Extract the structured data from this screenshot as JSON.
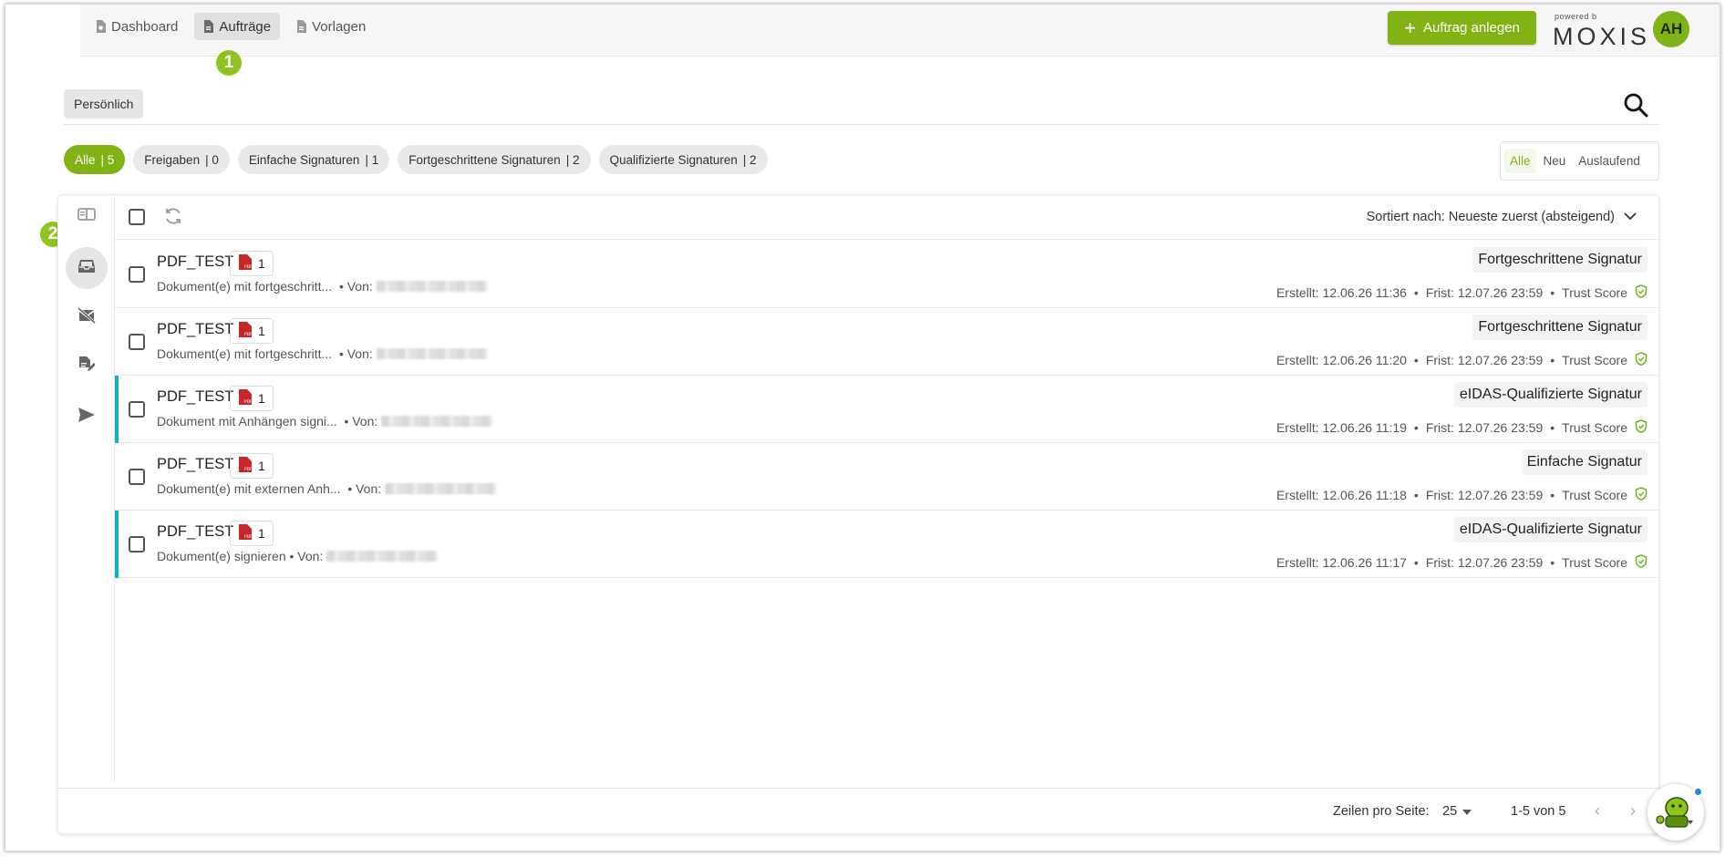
{
  "nav": {
    "items": [
      {
        "label": "Dashboard",
        "active": false
      },
      {
        "label": "Aufträge",
        "active": true
      },
      {
        "label": "Vorlagen",
        "active": false
      }
    ]
  },
  "annotations": {
    "one": "1",
    "two": "2"
  },
  "header": {
    "new_order_label": "Auftrag anlegen",
    "logo_powered": "powered b",
    "logo_name": "MOXIS",
    "avatar_initials": "AH",
    "accent_color": "#82b314"
  },
  "scope": {
    "label": "Persönlich"
  },
  "tabs": [
    {
      "label": "Alle",
      "count": "| 5",
      "active": true
    },
    {
      "label": "Freigaben",
      "count": "| 0",
      "active": false
    },
    {
      "label": "Einfache Signaturen",
      "count": "| 1",
      "active": false
    },
    {
      "label": "Fortgeschrittene Signaturen",
      "count": "| 2",
      "active": false
    },
    {
      "label": "Qualifizierte Signaturen",
      "count": "| 2",
      "active": false
    }
  ],
  "segments": [
    {
      "label": "Alle",
      "active": true
    },
    {
      "label": "Neu",
      "active": false
    },
    {
      "label": "Auslaufend",
      "active": false
    }
  ],
  "sidebar_icons": [
    "columns-icon",
    "inbox-icon",
    "hidden-mail-icon",
    "doc-edit-icon",
    "send-icon"
  ],
  "list": {
    "sort_label": "Sortiert nach: Neueste zuerst (absteigend)",
    "rows": [
      {
        "title": "PDF_TEST",
        "pdf_count": "1",
        "desc": "Dokument(e) mit fortgeschritt...",
        "from": "• Von:",
        "sigtype": "Fortgeschrittene Signatur",
        "created": "Erstellt: 12.06.26 11:36",
        "deadline": "Frist: 12.07.26 23:59",
        "trust": "Trust Score",
        "flag": false
      },
      {
        "title": "PDF_TEST",
        "pdf_count": "1",
        "desc": "Dokument(e) mit fortgeschritt...",
        "from": "• Von:",
        "sigtype": "Fortgeschrittene Signatur",
        "created": "Erstellt: 12.06.26 11:20",
        "deadline": "Frist: 12.07.26 23:59",
        "trust": "Trust Score",
        "flag": false
      },
      {
        "title": "PDF_TEST",
        "pdf_count": "1",
        "desc": "Dokument mit Anhängen signi...",
        "from": "• Von:",
        "sigtype": "eIDAS-Qualifizierte Signatur",
        "created": "Erstellt: 12.06.26 11:19",
        "deadline": "Frist: 12.07.26 23:59",
        "trust": "Trust Score",
        "flag": true
      },
      {
        "title": "PDF_TEST",
        "pdf_count": "1",
        "desc": "Dokument(e) mit externen Anh...",
        "from": "• Von:",
        "sigtype": "Einfache Signatur",
        "created": "Erstellt: 12.06.26 11:18",
        "deadline": "Frist: 12.07.26 23:59",
        "trust": "Trust Score",
        "flag": false
      },
      {
        "title": "PDF_TEST",
        "pdf_count": "1",
        "desc": "Dokument(e) signieren",
        "from": "• Von:",
        "sigtype": "eIDAS-Qualifizierte Signatur",
        "created": "Erstellt: 12.06.26 11:17",
        "deadline": "Frist: 12.07.26 23:59",
        "trust": "Trust Score",
        "flag": true
      }
    ]
  },
  "footer": {
    "rows_per_page_label": "Zeilen pro Seite:",
    "rows_per_page_value": "25",
    "range": "1-5 von 5"
  }
}
